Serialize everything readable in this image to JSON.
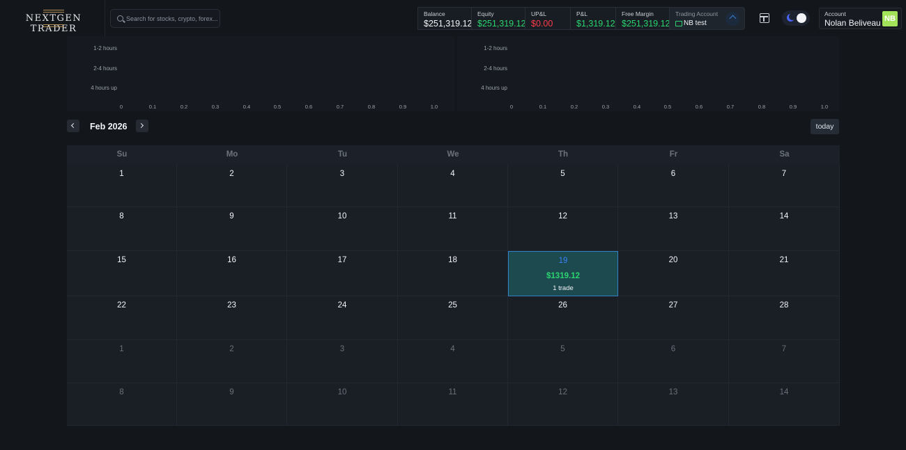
{
  "header": {
    "logo_text": "NEXTGEN TRADER",
    "search_placeholder": "Search for stocks, crypto, forex...",
    "stats": [
      {
        "label": "Balance",
        "value": "$251,319.12",
        "color": "white"
      },
      {
        "label": "Equity",
        "value": "$251,319.12",
        "color": "green"
      },
      {
        "label": "UP&L",
        "value": "$0.00",
        "color": "red"
      },
      {
        "label": "P&L",
        "value": "$1,319.12",
        "color": "green"
      },
      {
        "label": "Free Margin",
        "value": "$251,319.12",
        "color": "green"
      }
    ],
    "trading_account": {
      "label": "Trading Account",
      "name": "NB test"
    },
    "account": {
      "label": "Account",
      "name": "Nolan Beliveau",
      "initials": "NB"
    }
  },
  "charts": {
    "left": {
      "y_labels": [
        "1-2 hours",
        "2-4 hours",
        "4 hours up"
      ],
      "x_ticks": [
        "0",
        "0.1",
        "0.2",
        "0.3",
        "0.4",
        "0.5",
        "0.6",
        "0.7",
        "0.8",
        "0.9",
        "1.0"
      ]
    },
    "right": {
      "y_labels": [
        "1-2 hours",
        "2-4 hours",
        "4 hours up"
      ],
      "x_ticks": [
        "0",
        "0.1",
        "0.2",
        "0.3",
        "0.4",
        "0.5",
        "0.6",
        "0.7",
        "0.8",
        "0.9",
        "1.0"
      ]
    }
  },
  "calendar": {
    "month_title": "Feb 2026",
    "today_label": "today",
    "weekdays": [
      "Su",
      "Mo",
      "Tu",
      "We",
      "Th",
      "Fr",
      "Sa"
    ],
    "weeks": [
      [
        {
          "d": "1"
        },
        {
          "d": "2"
        },
        {
          "d": "3"
        },
        {
          "d": "4"
        },
        {
          "d": "5"
        },
        {
          "d": "6"
        },
        {
          "d": "7"
        }
      ],
      [
        {
          "d": "8"
        },
        {
          "d": "9"
        },
        {
          "d": "10"
        },
        {
          "d": "11"
        },
        {
          "d": "12"
        },
        {
          "d": "13"
        },
        {
          "d": "14"
        }
      ],
      [
        {
          "d": "15"
        },
        {
          "d": "16"
        },
        {
          "d": "17"
        },
        {
          "d": "18"
        },
        {
          "d": "19",
          "active": true,
          "pnl": "$1319.12",
          "trades": "1 trade"
        },
        {
          "d": "20"
        },
        {
          "d": "21"
        }
      ],
      [
        {
          "d": "22"
        },
        {
          "d": "23"
        },
        {
          "d": "24"
        },
        {
          "d": "25"
        },
        {
          "d": "26"
        },
        {
          "d": "27"
        },
        {
          "d": "28"
        }
      ],
      [
        {
          "d": "1",
          "other": true
        },
        {
          "d": "2",
          "other": true
        },
        {
          "d": "3",
          "other": true
        },
        {
          "d": "4",
          "other": true
        },
        {
          "d": "5",
          "other": true
        },
        {
          "d": "6",
          "other": true
        },
        {
          "d": "7",
          "other": true
        }
      ],
      [
        {
          "d": "8",
          "other": true
        },
        {
          "d": "9",
          "other": true
        },
        {
          "d": "10",
          "other": true
        },
        {
          "d": "11",
          "other": true
        },
        {
          "d": "12",
          "other": true
        },
        {
          "d": "13",
          "other": true
        },
        {
          "d": "14",
          "other": true
        }
      ]
    ]
  },
  "colors": {
    "background": "#13171c",
    "positive": "#2bd46f",
    "negative": "#ff3b4a",
    "active_day_bg": "#1c4a4f",
    "active_day_border": "#2f83c6",
    "avatar": "#a3e35a"
  }
}
